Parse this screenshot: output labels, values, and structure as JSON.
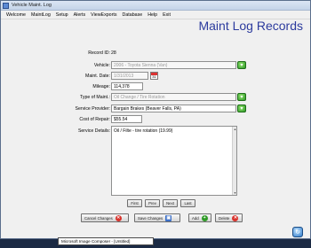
{
  "window": {
    "title": "Vehicle Maint. Log"
  },
  "menu": [
    "Welcome",
    "MaintLog",
    "Setup",
    "Alerts",
    "ViewExports",
    "Database",
    "Help",
    "Exit"
  ],
  "page_title": "Maint Log Records",
  "form": {
    "record_id": {
      "label": "Record ID:",
      "value": "28"
    },
    "vehicle": {
      "label": "Vehicle:",
      "value": "2006 - Toyota Sienna (Van)"
    },
    "maint_date": {
      "label": "Maint. Date:",
      "value": "1/31/2013",
      "calendar_day": "31"
    },
    "mileage": {
      "label": "Mileage:",
      "value": "114,378"
    },
    "type_of_maint": {
      "label": "Type of Maint.:",
      "value": "Oil Change / Tire Rotation"
    },
    "service_provider": {
      "label": "Service Provider:",
      "value": "Bargain Brakes (Beaver Falls, PA)"
    },
    "cost_of_repair": {
      "label": "Cost of Repair:",
      "value": "$55.54"
    },
    "service_details": {
      "label": "Service Details:",
      "value": "Oil / Filte - tire rotation (19.99)"
    }
  },
  "nav_buttons": [
    "First",
    "Prev",
    "Next",
    "Last"
  ],
  "actions": {
    "cancel": "Cancel Changes",
    "save": "Save Changes",
    "add": "Add",
    "delete": "Delete"
  },
  "tooltip": "Microsoft Image Composer - [Untitled]",
  "colors": {
    "title": "#2c3b9e",
    "dropdown": "#2f9a27",
    "delete": "#d8322c"
  }
}
